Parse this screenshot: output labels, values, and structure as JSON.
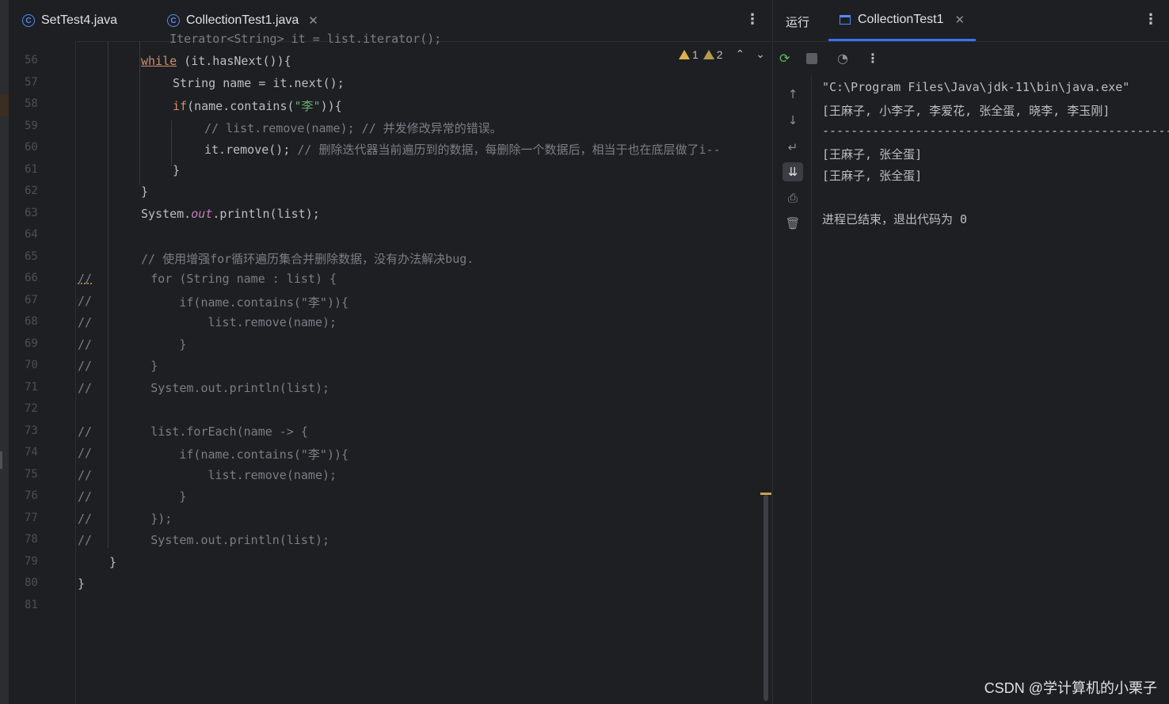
{
  "editor": {
    "tabs": [
      {
        "label": "SetTest4.java",
        "icon": "class-icon"
      },
      {
        "label": "CollectionTest1.java",
        "icon": "class-icon",
        "active": true
      }
    ],
    "inspection": {
      "warnings": "1",
      "weak_warnings": "2"
    },
    "partial_top_line": "    Iterator<String> it = list.iterator();",
    "lines": [
      {
        "n": "56"
      },
      {
        "n": "57"
      },
      {
        "n": "58"
      },
      {
        "n": "59"
      },
      {
        "n": "60"
      },
      {
        "n": "61"
      },
      {
        "n": "62"
      },
      {
        "n": "63"
      },
      {
        "n": "64"
      },
      {
        "n": "65"
      },
      {
        "n": "66"
      },
      {
        "n": "67"
      },
      {
        "n": "68"
      },
      {
        "n": "69"
      },
      {
        "n": "70"
      },
      {
        "n": "71"
      },
      {
        "n": "72"
      },
      {
        "n": "73"
      },
      {
        "n": "74"
      },
      {
        "n": "75"
      },
      {
        "n": "76"
      },
      {
        "n": "77"
      },
      {
        "n": "78"
      },
      {
        "n": "79"
      },
      {
        "n": "80"
      },
      {
        "n": "81"
      }
    ],
    "code": {
      "l56_kw": "while",
      "l56_rest": " (it.hasNext()){",
      "l57": "String name = it.next();",
      "l58_kw": "if",
      "l58_a": "(name.contains(",
      "l58_str": "\"李\"",
      "l58_b": ")){",
      "l59": "// list.remove(name); // 并发修改异常的错误。",
      "l60_code": "it.remove();",
      "l60_cm": " // 删除迭代器当前遍历到的数据，每删除一个数据后，相当于也在底层做了i--",
      "l61": "}",
      "l62": "}",
      "l63_a": "System.",
      "l63_fld": "out",
      "l63_b": ".println(list);",
      "l65": "// 使用增强for循环遍历集合并删除数据，没有办法解决bug.",
      "l66_c": "//",
      "l66": "        for (String name : list) {",
      "l67_c": "//",
      "l67": "            if(name.contains(\"李\")){",
      "l68_c": "//",
      "l68": "                list.remove(name);",
      "l69_c": "//",
      "l69": "            }",
      "l70_c": "//",
      "l70": "        }",
      "l71_c": "//",
      "l71": "        System.out.println(list);",
      "l73_c": "//",
      "l73": "        list.forEach(name -> {",
      "l74_c": "//",
      "l74": "            if(name.contains(\"李\")){",
      "l75_c": "//",
      "l75": "                list.remove(name);",
      "l76_c": "//",
      "l76": "            }",
      "l77_c": "//",
      "l77": "        });",
      "l78_c": "//",
      "l78": "        System.out.println(list);",
      "l79": "}",
      "l80": "}"
    }
  },
  "run": {
    "title": "运行",
    "tab_label": "CollectionTest1",
    "toolbar_icons": [
      "rerun-icon",
      "stop-icon",
      "profiler-icon",
      "more-icon"
    ],
    "side_icons": [
      "up-arrow-icon",
      "down-arrow-icon",
      "soft-wrap-icon",
      "scroll-to-end-icon",
      "print-icon",
      "trash-icon"
    ],
    "console": [
      "\"C:\\Program Files\\Java\\jdk-11\\bin\\java.exe\"",
      "[王麻子, 小李子, 李爱花, 张全蛋, 晓李, 李玉刚]",
      "-------------------------------------------------",
      "[王麻子, 张全蛋]",
      "[王麻子, 张全蛋]",
      "",
      "进程已结束，退出代码为 0"
    ]
  },
  "watermark": "CSDN @学计算机的小栗子",
  "colors": {
    "keyword": "#cf8e6d",
    "string": "#6aab73",
    "comment": "#7a7e85",
    "field": "#c77dbb",
    "accent": "#3574f0",
    "background": "#1e1f22"
  }
}
